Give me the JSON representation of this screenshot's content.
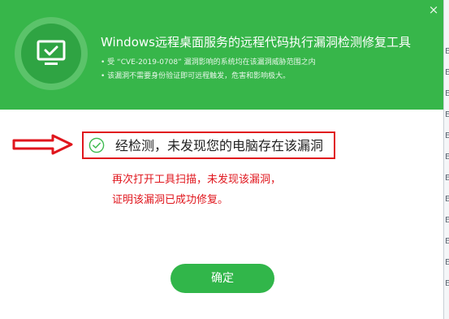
{
  "header": {
    "title": "Windows远程桌面服务的远程代码执行漏洞检测修复工具",
    "notes": [
      "• 受 “CVE-2019-0708” 漏洞影响的系统均在该漏洞威胁范围之内",
      "• 该漏洞不需要身份验证即可远程触发，危害和影响极大。"
    ],
    "close_label": "×"
  },
  "result": {
    "message": "经检测，未发现您的电脑存在该漏洞"
  },
  "annotation": {
    "lines": [
      "再次打开工具扫描，未发现该漏洞，",
      "证明该漏洞已成功修复。"
    ]
  },
  "confirm_label": "确定",
  "background_window": {
    "letters": [
      "E",
      "E",
      "E",
      "E",
      "E",
      "E",
      "E",
      "E",
      "E",
      "E",
      "E",
      "E"
    ]
  },
  "colors": {
    "header_green": "#37b64a",
    "button_green": "#31b64a",
    "highlight_red": "#e0161d",
    "check_green": "#3dbb4e"
  },
  "icons": {
    "logo": "monitor-check-icon",
    "arrow": "right-arrow-icon",
    "check": "check-circle-icon",
    "close": "close-icon"
  }
}
